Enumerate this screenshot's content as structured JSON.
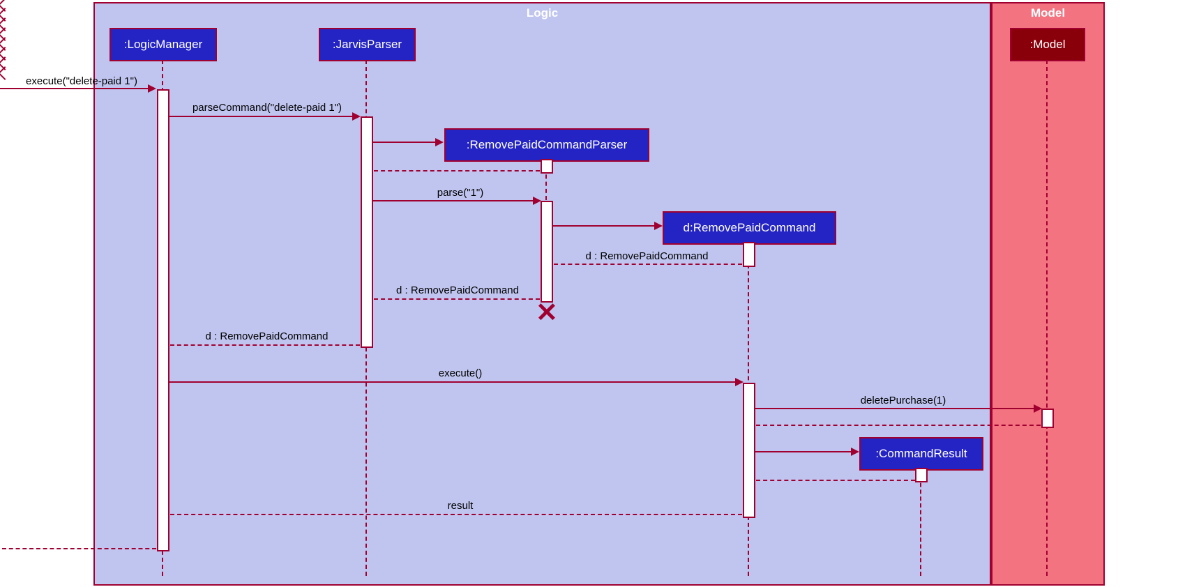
{
  "frames": {
    "logic": "Logic",
    "model": "Model"
  },
  "participants": {
    "logicManager": ":LogicManager",
    "jarvisParser": ":JarvisParser",
    "removePaidCommandParser": ":RemovePaidCommandParser",
    "removePaidCommand": "d:RemovePaidCommand",
    "commandResult": ":CommandResult",
    "model": ":Model"
  },
  "messages": {
    "execute1": "execute(\"delete-paid 1\")",
    "parseCommand": "parseCommand(\"delete-paid 1\")",
    "parse": "parse(\"1\")",
    "returnD1": "d : RemovePaidCommand",
    "returnD2": "d : RemovePaidCommand",
    "returnD3": "d : RemovePaidCommand",
    "execute2": "execute()",
    "deletePurchase": "deletePurchase(1)",
    "result": "result"
  }
}
